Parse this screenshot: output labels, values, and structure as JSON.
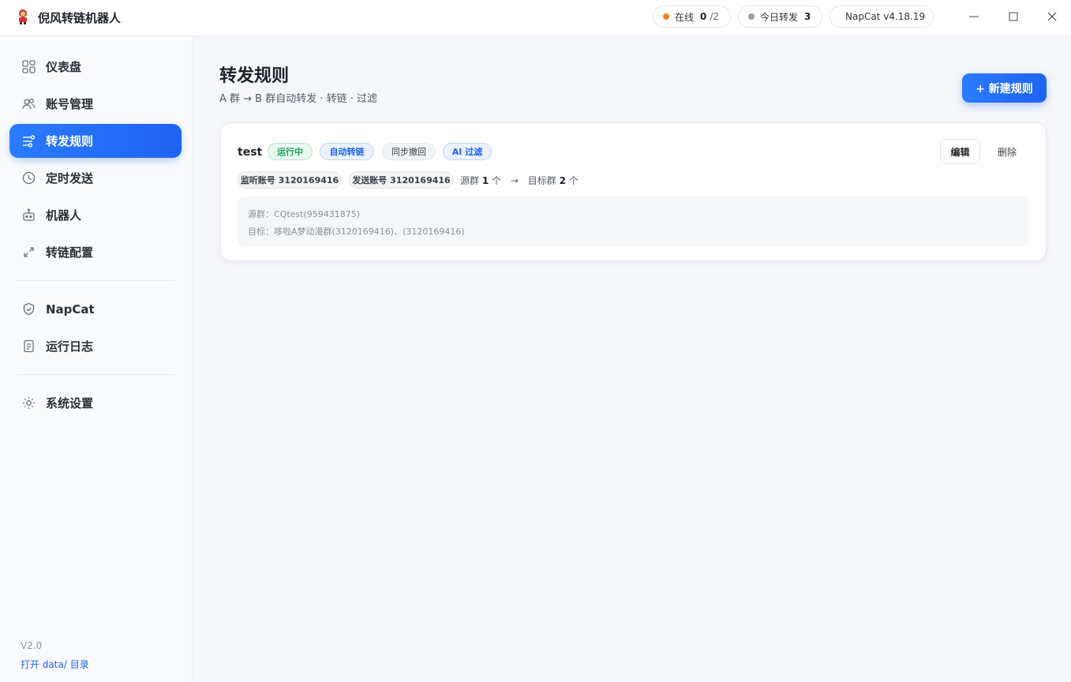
{
  "app": {
    "title": "倪风转链机器人"
  },
  "status": {
    "online_label": "在线",
    "online_count": "0",
    "online_total": "/2",
    "today_label": "今日转发",
    "today_count": "3",
    "napcat_label": "NapCat v4.18.19",
    "colors": {
      "online_dot": "#f5822a",
      "today_dot": "#9aa0aa",
      "napcat_dot": "#1fc27a"
    }
  },
  "sidebar": {
    "items": [
      {
        "label": "仪表盘",
        "icon": "dashboard-icon"
      },
      {
        "label": "账号管理",
        "icon": "users-icon"
      },
      {
        "label": "转发规则",
        "icon": "sliders-icon",
        "active": true
      },
      {
        "label": "定时发送",
        "icon": "clock-icon"
      },
      {
        "label": "机器人",
        "icon": "robot-icon"
      },
      {
        "label": "转链配置",
        "icon": "link-arrows-icon"
      },
      {
        "label": "NapCat",
        "icon": "shield-icon"
      },
      {
        "label": "运行日志",
        "icon": "document-icon"
      },
      {
        "label": "系统设置",
        "icon": "sun-gear-icon"
      }
    ],
    "version": "V2.0",
    "open_data": "打开 data/ 目录"
  },
  "main": {
    "title": "转发规则",
    "subtitle": "A 群 → B 群自动转发 · 转链 · 过滤",
    "new_rule_label": "+ 新建规则"
  },
  "rules": [
    {
      "name": "test",
      "tags": {
        "running": "运行中",
        "auto_link": "自动转链",
        "sync_recall": "同步撤回",
        "ai_filter": "AI 过滤"
      },
      "edit_label": "编辑",
      "delete_label": "删除",
      "listen_account": "监听账号 3120169416",
      "send_account": "发送账号 3120169416",
      "source_prefix": "源群",
      "source_count": "1",
      "unit": "个",
      "arrow": "→",
      "target_prefix": "目标群",
      "target_count": "2",
      "source_detail": "源群：CQtest(959431875)",
      "target_detail": "目标：哆啦A梦动漫群(3120169416)、(3120169416)"
    }
  ]
}
